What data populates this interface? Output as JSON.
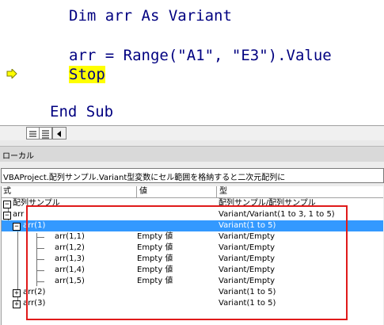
{
  "code": {
    "line_dim": "Dim arr As Variant",
    "line_assign": "arr = Range(\"A1\", \"E3\").Value",
    "line_stop": "Stop",
    "line_end": "End Sub"
  },
  "locals": {
    "title": "ローカル",
    "context": "VBAProject.配列サンプル.Variant型変数にセル範囲を格納すると二次元配列に",
    "headers": {
      "expr": "式",
      "value": "値",
      "type": "型"
    },
    "rows": [
      {
        "expr": "配列サンプル",
        "value": "",
        "type": "配列サンプル/配列サンプル"
      },
      {
        "expr": "arr",
        "value": "",
        "type": "Variant/Variant(1 to 3, 1 to 5)"
      },
      {
        "expr": "arr(1)",
        "value": "",
        "type": "Variant(1 to 5)"
      },
      {
        "expr": "arr(1,1)",
        "value": "Empty 値",
        "type": "Variant/Empty"
      },
      {
        "expr": "arr(1,2)",
        "value": "Empty 値",
        "type": "Variant/Empty"
      },
      {
        "expr": "arr(1,3)",
        "value": "Empty 値",
        "type": "Variant/Empty"
      },
      {
        "expr": "arr(1,4)",
        "value": "Empty 値",
        "type": "Variant/Empty"
      },
      {
        "expr": "arr(1,5)",
        "value": "Empty 値",
        "type": "Variant/Empty"
      },
      {
        "expr": "arr(2)",
        "value": "",
        "type": "Variant(1 to 5)"
      },
      {
        "expr": "arr(3)",
        "value": "",
        "type": "Variant(1 to 5)"
      }
    ]
  },
  "colors": {
    "code_text": "#000080",
    "stop_highlight": "#ffff00",
    "selection": "#3399ff",
    "annotation_box": "#e01a1a"
  }
}
